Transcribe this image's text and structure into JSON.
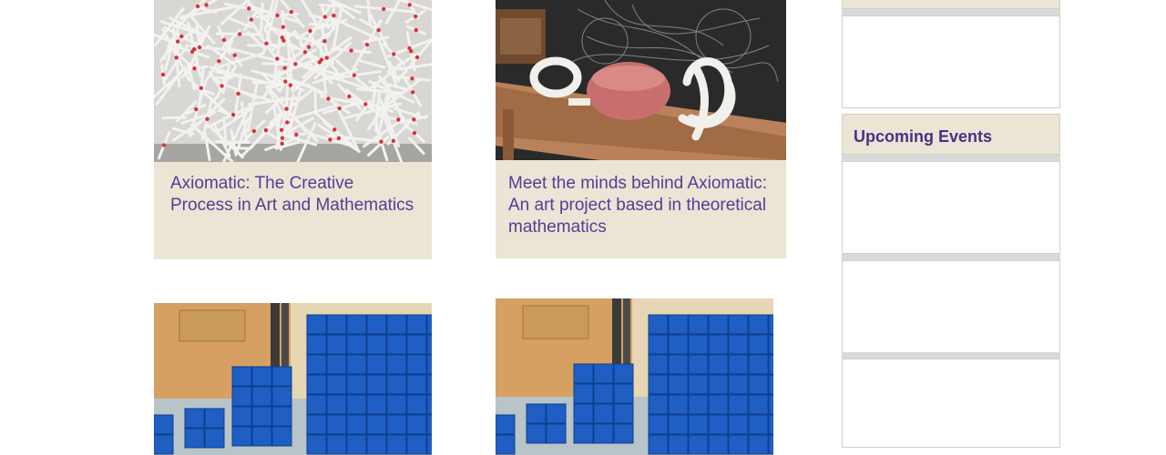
{
  "articles": [
    {
      "title": "Axiomatic: The Creative Process in Art and Mathematics"
    },
    {
      "title": "Meet the minds behind Axiomatic: An art project based in theoretical mathematics"
    }
  ],
  "sidebar": {
    "upcoming_events_heading": "Upcoming Events"
  },
  "colors": {
    "caption_background": "#ebe5d6",
    "link_purple": "#5a3a96",
    "heading_purple": "#4a2f86",
    "divider_gray": "#d9d9d9"
  },
  "icons": []
}
